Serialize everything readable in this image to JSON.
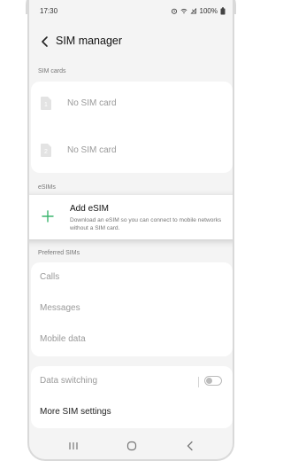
{
  "status_bar": {
    "time": "17:30",
    "battery": "100%"
  },
  "header": {
    "title": "SIM manager"
  },
  "sim_cards": {
    "label": "SIM cards",
    "items": [
      {
        "slot": "1",
        "text": "No SIM card"
      },
      {
        "slot": "2",
        "text": "No SIM card"
      }
    ]
  },
  "esims": {
    "label": "eSIMs",
    "add_title": "Add eSIM",
    "add_description": "Download an eSIM so you can connect to mobile networks without a SIM card."
  },
  "preferred_sims": {
    "label": "Preferred SIMs",
    "items": [
      "Calls",
      "Messages",
      "Mobile data"
    ]
  },
  "data_switching": {
    "label": "Data switching",
    "enabled": false
  },
  "more_settings": "More SIM settings",
  "colors": {
    "accent_green": "#3bb56e",
    "background": "#f4f4f4",
    "card": "#ffffff"
  }
}
